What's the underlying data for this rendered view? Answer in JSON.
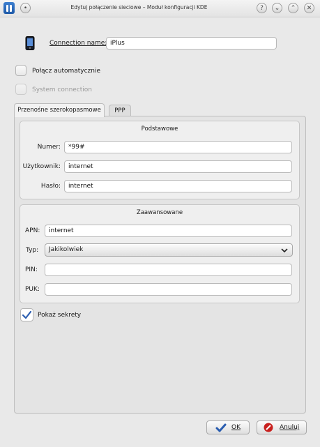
{
  "window": {
    "title": "Edytuj połączenie sieciowe – Moduł konfiguracji KDE",
    "help_glyph": "?",
    "shade_glyph": "⌄",
    "maximize_glyph": "⌃",
    "close_glyph": "✕"
  },
  "connection": {
    "name_label": "Connection name:",
    "name_value": "iPlus",
    "auto_connect_label": "Połącz automatycznie",
    "system_connection_label": "System connection"
  },
  "tabs": [
    {
      "label": "Przenośne szerokopasmowe",
      "active": true
    },
    {
      "label": "PPP",
      "active": false
    }
  ],
  "basic": {
    "title": "Podstawowe",
    "number_label": "Numer:",
    "number_value": "*99#",
    "user_label": "Użytkownik:",
    "user_value": "internet",
    "password_label": "Hasło:",
    "password_value": "internet"
  },
  "advanced": {
    "title": "Zaawansowane",
    "apn_label": "APN:",
    "apn_value": "internet",
    "type_label": "Typ:",
    "type_value": "Jakikolwiek",
    "pin_label": "PIN:",
    "pin_value": "",
    "puk_label": "PUK:",
    "puk_value": ""
  },
  "show_secrets": {
    "label": "Pokaż sekrety",
    "checked": true
  },
  "buttons": {
    "ok_label": "OK",
    "cancel_label": "Anuluj"
  },
  "colors": {
    "ok_check": "#2a5db0",
    "cancel_red": "#c8201e",
    "checkbox_check": "#2a5db0"
  }
}
